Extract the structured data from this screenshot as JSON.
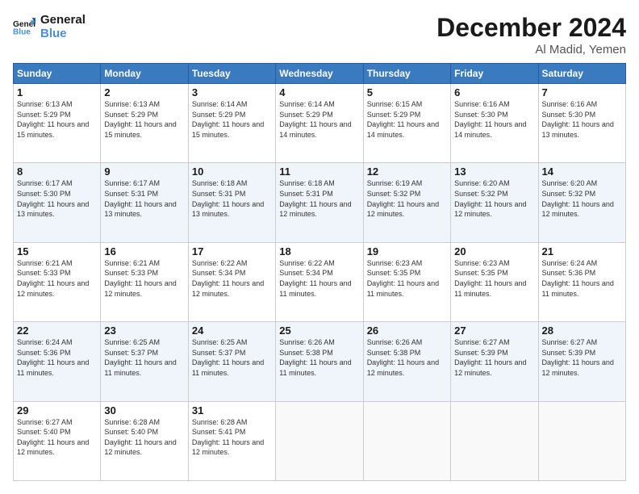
{
  "logo": {
    "line1": "General",
    "line2": "Blue"
  },
  "header": {
    "month": "December 2024",
    "location": "Al Madid, Yemen"
  },
  "days_of_week": [
    "Sunday",
    "Monday",
    "Tuesday",
    "Wednesday",
    "Thursday",
    "Friday",
    "Saturday"
  ],
  "weeks": [
    [
      {
        "day": "1",
        "sunrise": "6:13 AM",
        "sunset": "5:29 PM",
        "daylight": "11 hours and 15 minutes."
      },
      {
        "day": "2",
        "sunrise": "6:13 AM",
        "sunset": "5:29 PM",
        "daylight": "11 hours and 15 minutes."
      },
      {
        "day": "3",
        "sunrise": "6:14 AM",
        "sunset": "5:29 PM",
        "daylight": "11 hours and 15 minutes."
      },
      {
        "day": "4",
        "sunrise": "6:14 AM",
        "sunset": "5:29 PM",
        "daylight": "11 hours and 14 minutes."
      },
      {
        "day": "5",
        "sunrise": "6:15 AM",
        "sunset": "5:29 PM",
        "daylight": "11 hours and 14 minutes."
      },
      {
        "day": "6",
        "sunrise": "6:16 AM",
        "sunset": "5:30 PM",
        "daylight": "11 hours and 14 minutes."
      },
      {
        "day": "7",
        "sunrise": "6:16 AM",
        "sunset": "5:30 PM",
        "daylight": "11 hours and 13 minutes."
      }
    ],
    [
      {
        "day": "8",
        "sunrise": "6:17 AM",
        "sunset": "5:30 PM",
        "daylight": "11 hours and 13 minutes."
      },
      {
        "day": "9",
        "sunrise": "6:17 AM",
        "sunset": "5:31 PM",
        "daylight": "11 hours and 13 minutes."
      },
      {
        "day": "10",
        "sunrise": "6:18 AM",
        "sunset": "5:31 PM",
        "daylight": "11 hours and 13 minutes."
      },
      {
        "day": "11",
        "sunrise": "6:18 AM",
        "sunset": "5:31 PM",
        "daylight": "11 hours and 12 minutes."
      },
      {
        "day": "12",
        "sunrise": "6:19 AM",
        "sunset": "5:32 PM",
        "daylight": "11 hours and 12 minutes."
      },
      {
        "day": "13",
        "sunrise": "6:20 AM",
        "sunset": "5:32 PM",
        "daylight": "11 hours and 12 minutes."
      },
      {
        "day": "14",
        "sunrise": "6:20 AM",
        "sunset": "5:32 PM",
        "daylight": "11 hours and 12 minutes."
      }
    ],
    [
      {
        "day": "15",
        "sunrise": "6:21 AM",
        "sunset": "5:33 PM",
        "daylight": "11 hours and 12 minutes."
      },
      {
        "day": "16",
        "sunrise": "6:21 AM",
        "sunset": "5:33 PM",
        "daylight": "11 hours and 12 minutes."
      },
      {
        "day": "17",
        "sunrise": "6:22 AM",
        "sunset": "5:34 PM",
        "daylight": "11 hours and 12 minutes."
      },
      {
        "day": "18",
        "sunrise": "6:22 AM",
        "sunset": "5:34 PM",
        "daylight": "11 hours and 11 minutes."
      },
      {
        "day": "19",
        "sunrise": "6:23 AM",
        "sunset": "5:35 PM",
        "daylight": "11 hours and 11 minutes."
      },
      {
        "day": "20",
        "sunrise": "6:23 AM",
        "sunset": "5:35 PM",
        "daylight": "11 hours and 11 minutes."
      },
      {
        "day": "21",
        "sunrise": "6:24 AM",
        "sunset": "5:36 PM",
        "daylight": "11 hours and 11 minutes."
      }
    ],
    [
      {
        "day": "22",
        "sunrise": "6:24 AM",
        "sunset": "5:36 PM",
        "daylight": "11 hours and 11 minutes."
      },
      {
        "day": "23",
        "sunrise": "6:25 AM",
        "sunset": "5:37 PM",
        "daylight": "11 hours and 11 minutes."
      },
      {
        "day": "24",
        "sunrise": "6:25 AM",
        "sunset": "5:37 PM",
        "daylight": "11 hours and 11 minutes."
      },
      {
        "day": "25",
        "sunrise": "6:26 AM",
        "sunset": "5:38 PM",
        "daylight": "11 hours and 11 minutes."
      },
      {
        "day": "26",
        "sunrise": "6:26 AM",
        "sunset": "5:38 PM",
        "daylight": "11 hours and 12 minutes."
      },
      {
        "day": "27",
        "sunrise": "6:27 AM",
        "sunset": "5:39 PM",
        "daylight": "11 hours and 12 minutes."
      },
      {
        "day": "28",
        "sunrise": "6:27 AM",
        "sunset": "5:39 PM",
        "daylight": "11 hours and 12 minutes."
      }
    ],
    [
      {
        "day": "29",
        "sunrise": "6:27 AM",
        "sunset": "5:40 PM",
        "daylight": "11 hours and 12 minutes."
      },
      {
        "day": "30",
        "sunrise": "6:28 AM",
        "sunset": "5:40 PM",
        "daylight": "11 hours and 12 minutes."
      },
      {
        "day": "31",
        "sunrise": "6:28 AM",
        "sunset": "5:41 PM",
        "daylight": "11 hours and 12 minutes."
      },
      null,
      null,
      null,
      null
    ]
  ],
  "labels": {
    "sunrise": "Sunrise:",
    "sunset": "Sunset:",
    "daylight": "Daylight:"
  }
}
